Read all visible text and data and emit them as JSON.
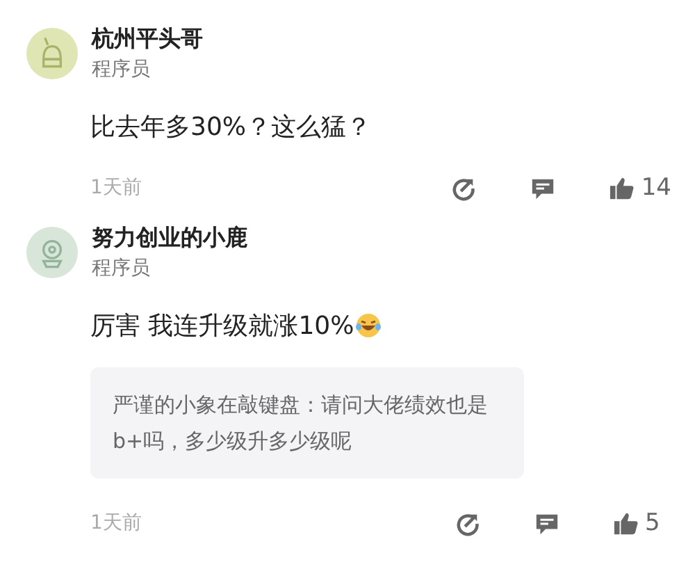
{
  "comments": [
    {
      "avatar": {
        "kind": "sprout"
      },
      "name": "杭州平头哥",
      "role": "程序员",
      "text": "比去年多30%？这么猛？",
      "emoji": false,
      "time": "1天前",
      "likes": "14"
    },
    {
      "avatar": {
        "kind": "bell"
      },
      "name": "努力创业的小鹿",
      "role": "程序员",
      "text": "厉害 我连升级就涨10%",
      "emoji": true,
      "quote": "严谨的小象在敲键盘：请问大佬绩效也是b+吗，多少级升多少级呢",
      "time": "1天前",
      "likes": "5"
    }
  ]
}
